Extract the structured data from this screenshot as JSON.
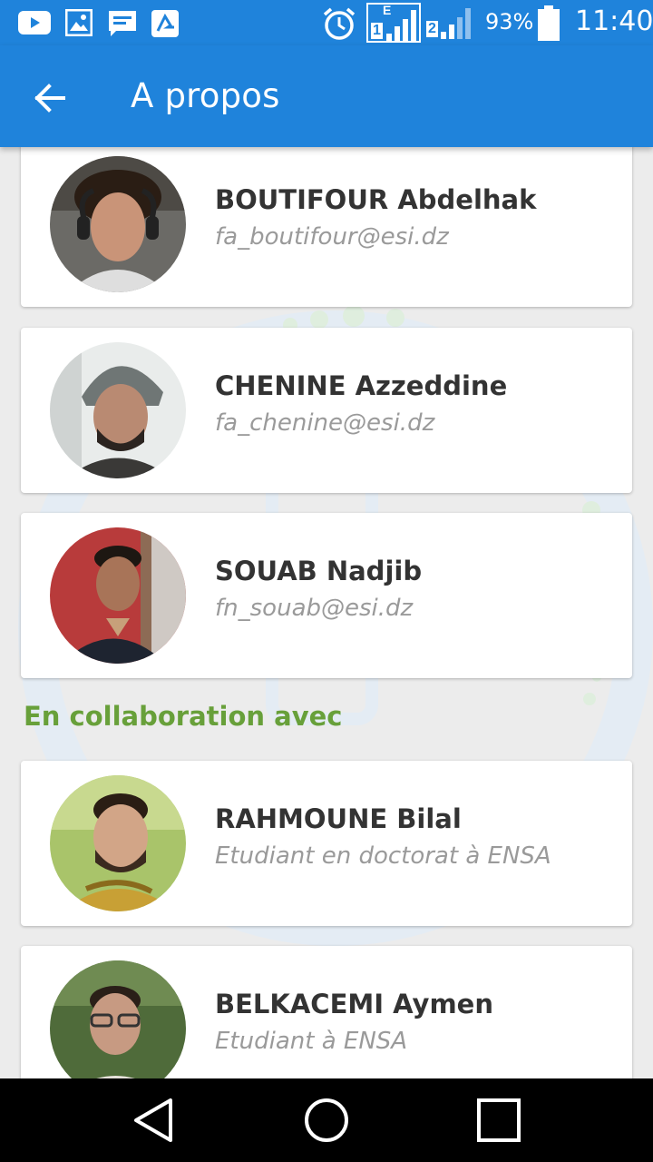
{
  "status_bar": {
    "network_type": "E",
    "sim1": "1",
    "sim2": "2",
    "battery": "93%",
    "time": "11:40",
    "icons": [
      "youtube-icon",
      "gallery-icon",
      "message-icon",
      "app-notification-icon",
      "alarm-icon",
      "signal-icon",
      "battery-icon"
    ]
  },
  "app_bar": {
    "title": "A propos",
    "back_icon": "arrow-back-icon",
    "color": "#1f83db"
  },
  "developers": [
    {
      "name": "BOUTIFOUR Abdelhak",
      "subtitle": "fa_boutifour@esi.dz"
    },
    {
      "name": "CHENINE Azzeddine",
      "subtitle": "fa_chenine@esi.dz"
    },
    {
      "name": "SOUAB Nadjib",
      "subtitle": "fn_souab@esi.dz"
    }
  ],
  "collaboration": {
    "heading": "En collaboration avec",
    "color": "#68a03a",
    "people": [
      {
        "name": "RAHMOUNE Bilal",
        "subtitle": "Etudiant en doctorat à ENSA"
      },
      {
        "name": "BELKACEMI Aymen",
        "subtitle": "Etudiant à ENSA"
      }
    ]
  },
  "nav_bar": {
    "icons": [
      "back-triangle-icon",
      "home-circle-icon",
      "recents-square-icon"
    ]
  }
}
